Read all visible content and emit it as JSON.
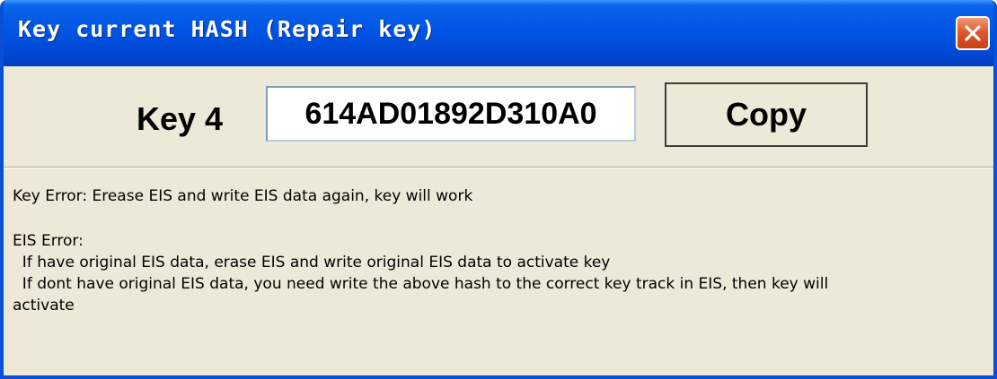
{
  "window": {
    "title": "Key current HASH (Repair key)",
    "close_icon": "close-icon"
  },
  "key_row": {
    "key_label": "Key 4",
    "hash_value": "614AD01892D310A0",
    "copy_label": "Copy"
  },
  "messages": {
    "key_error": "Key Error: Erease EIS and write EIS data again, key will work",
    "eis_error_heading": "EIS Error:",
    "eis_error_line1": "  If have original EIS data, erase EIS and write original EIS data to activate key",
    "eis_error_line2": "  If dont have original EIS data, you need write the above hash to the correct key track in EIS, then key will",
    "eis_error_line3": "activate"
  },
  "colors": {
    "titlebar": "#0055e5",
    "window_background": "#ece9d8",
    "close_button": "#e1582d"
  }
}
